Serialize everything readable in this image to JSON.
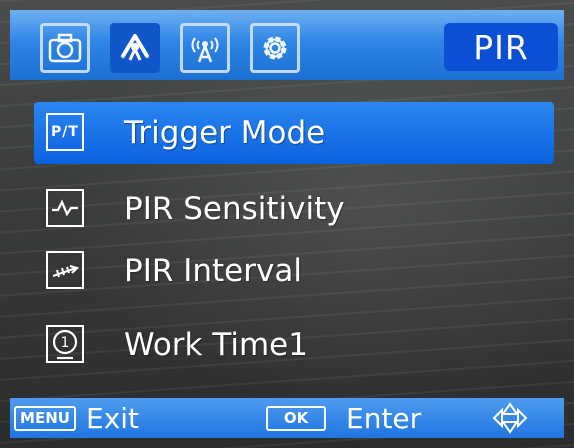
{
  "header": {
    "tabs": [
      {
        "icon": "camera-icon",
        "active": false
      },
      {
        "icon": "pir-sensor-icon",
        "active": true
      },
      {
        "icon": "wireless-signal-icon",
        "active": false
      },
      {
        "icon": "gear-icon",
        "active": false
      }
    ],
    "section_label": "PIR"
  },
  "menu": {
    "items": [
      {
        "icon_text": "P/T",
        "label": "Trigger Mode",
        "selected": true
      },
      {
        "icon": "sensitivity-wave-icon",
        "label": "PIR Sensitivity",
        "selected": false
      },
      {
        "icon": "interval-arrow-icon",
        "label": "PIR Interval",
        "selected": false
      },
      {
        "icon": "work-time-icon",
        "icon_text": "1",
        "label": "Work Time1",
        "selected": false
      }
    ]
  },
  "footer": {
    "menu_key": "MENU",
    "exit_label": "Exit",
    "ok_key": "OK",
    "enter_label": "Enter",
    "nav_icon": "direction-pad-icon"
  },
  "colors": {
    "accent": "#1c6fd3",
    "selected": "#0b62e0",
    "badge": "#0a4fd4",
    "text": "#ffffff"
  }
}
